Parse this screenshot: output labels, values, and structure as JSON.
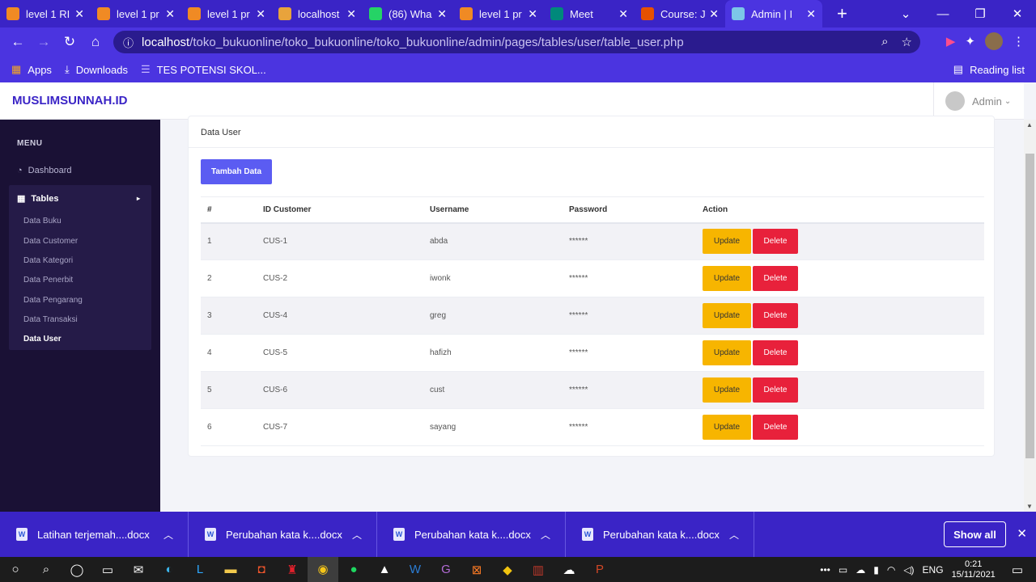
{
  "browser": {
    "tabs": [
      {
        "title": "level 1 RI",
        "color": "#f08a24"
      },
      {
        "title": "level 1 pr",
        "color": "#f08a24"
      },
      {
        "title": "level 1 pr",
        "color": "#f08a24"
      },
      {
        "title": "localhost",
        "color": "#e8a33c"
      },
      {
        "title": "(86) Wha",
        "color": "#25d366"
      },
      {
        "title": "level 1 pr",
        "color": "#f08a24"
      },
      {
        "title": "Meet",
        "color": "#00897b"
      },
      {
        "title": "Course: J",
        "color": "#e65100"
      },
      {
        "title": "Admin | I",
        "color": "#7cc6e8"
      }
    ],
    "url_host": "localhost",
    "url_path": "/toko_bukuonline/toko_bukuonline/toko_bukuonline/admin/pages/tables/user/table_user.php",
    "bookmarks": {
      "apps": "Apps",
      "downloads": "Downloads",
      "tes": "TES POTENSI SKOL...",
      "reading": "Reading list"
    }
  },
  "app": {
    "brand": "MUSLIMSUNNAH.ID",
    "admin": "Admin"
  },
  "sidebar": {
    "menu": "MENU",
    "dashboard": "Dashboard",
    "tables": "Tables",
    "subs": [
      "Data Buku",
      "Data Customer",
      "Data Kategori",
      "Data Penerbit",
      "Data Pengarang",
      "Data Transaksi",
      "Data User"
    ]
  },
  "card": {
    "title": "Data User",
    "add": "Tambah Data"
  },
  "table": {
    "headers": [
      "#",
      "ID Customer",
      "Username",
      "Password",
      "Action"
    ],
    "rows": [
      {
        "n": "1",
        "id": "CUS-1",
        "user": "abda",
        "pw": "******"
      },
      {
        "n": "2",
        "id": "CUS-2",
        "user": "iwonk",
        "pw": "******"
      },
      {
        "n": "3",
        "id": "CUS-4",
        "user": "greg",
        "pw": "******"
      },
      {
        "n": "4",
        "id": "CUS-5",
        "user": "hafizh",
        "pw": "******"
      },
      {
        "n": "5",
        "id": "CUS-6",
        "user": "cust",
        "pw": "******"
      },
      {
        "n": "6",
        "id": "CUS-7",
        "user": "sayang",
        "pw": "******"
      }
    ],
    "update": "Update",
    "delete": "Delete"
  },
  "downloads": {
    "items": [
      "Latihan terjemah....docx",
      "Perubahan kata k....docx",
      "Perubahan kata k....docx",
      "Perubahan kata k....docx"
    ],
    "show_all": "Show all"
  },
  "taskbar": {
    "lang": "ENG",
    "time": "0:21",
    "date": "15/11/2021"
  }
}
